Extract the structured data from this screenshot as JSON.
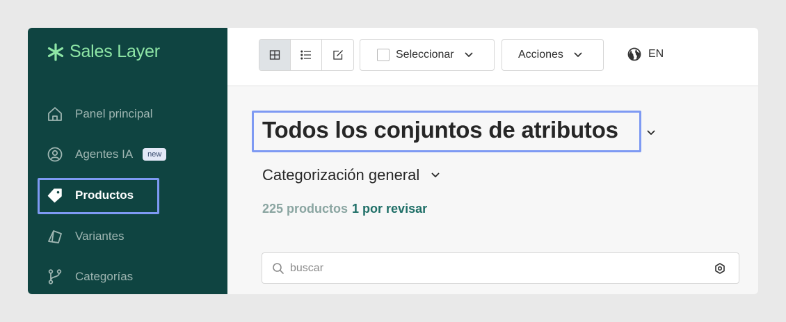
{
  "brand": {
    "name": "Sales Layer",
    "color": "#8ee6a6"
  },
  "sidebar": {
    "items": [
      {
        "label": "Panel principal",
        "icon": "home-icon"
      },
      {
        "label": "Agentes IA",
        "icon": "ai-agent-icon",
        "badge": "new"
      },
      {
        "label": "Productos",
        "icon": "tag-icon",
        "active": true
      },
      {
        "label": "Variantes",
        "icon": "variants-icon"
      },
      {
        "label": "Categorías",
        "icon": "branch-icon"
      }
    ]
  },
  "toolbar": {
    "view_modes": [
      "grid-view-icon",
      "list-view-icon",
      "edit-view-icon"
    ],
    "select_label": "Seleccionar",
    "actions_label": "Acciones",
    "language": "EN"
  },
  "main": {
    "title": "Todos los conjuntos de atributos",
    "subtitle": "Categorización general",
    "count_total": "225 productos",
    "count_review": "1 por revisar",
    "search_placeholder": "buscar"
  },
  "colors": {
    "sidebar_bg": "#0f4441",
    "highlight": "#7e9af3",
    "review_text": "#1f6f67"
  }
}
